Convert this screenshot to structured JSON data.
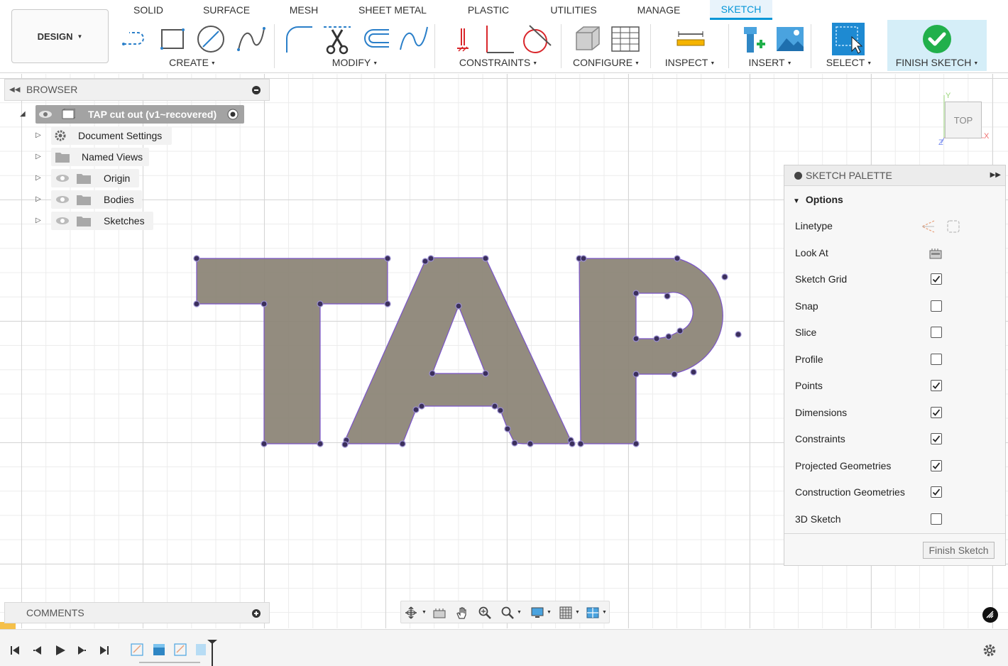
{
  "toolbar": {
    "workspace": "DESIGN",
    "tabs": [
      "SOLID",
      "SURFACE",
      "MESH",
      "SHEET METAL",
      "PLASTIC",
      "UTILITIES",
      "MANAGE",
      "SKETCH"
    ],
    "active_tab": "SKETCH",
    "groups": {
      "create": "CREATE",
      "modify": "MODIFY",
      "constraints": "CONSTRAINTS",
      "configure": "CONFIGURE",
      "inspect": "INSPECT",
      "insert": "INSERT",
      "select": "SELECT",
      "finish": "FINISH SKETCH"
    }
  },
  "browser": {
    "title": "BROWSER",
    "root": "TAP cut out (v1~recovered)",
    "items": [
      "Document Settings",
      "Named Views",
      "Origin",
      "Bodies",
      "Sketches"
    ]
  },
  "palette": {
    "title": "SKETCH PALETTE",
    "section": "Options",
    "linetype_label": "Linetype",
    "lookat_label": "Look At",
    "options": [
      {
        "label": "Sketch Grid",
        "checked": true
      },
      {
        "label": "Snap",
        "checked": false
      },
      {
        "label": "Slice",
        "checked": false
      },
      {
        "label": "Profile",
        "checked": false
      },
      {
        "label": "Points",
        "checked": true
      },
      {
        "label": "Dimensions",
        "checked": true
      },
      {
        "label": "Constraints",
        "checked": true
      },
      {
        "label": "Projected Geometries",
        "checked": true
      },
      {
        "label": "Construction Geometries",
        "checked": true
      },
      {
        "label": "3D Sketch",
        "checked": false
      }
    ],
    "finish_button": "Finish Sketch"
  },
  "viewcube": {
    "face": "TOP",
    "axis_x": "X",
    "axis_y": "Y",
    "axis_z": "Z"
  },
  "comments": {
    "title": "COMMENTS"
  },
  "colors": {
    "accent": "#0696d7",
    "sketch_fill": "#8a8274",
    "sketch_stroke": "#7b54c9",
    "point": "#3b2f5c",
    "finish_green": "#21b04b"
  }
}
